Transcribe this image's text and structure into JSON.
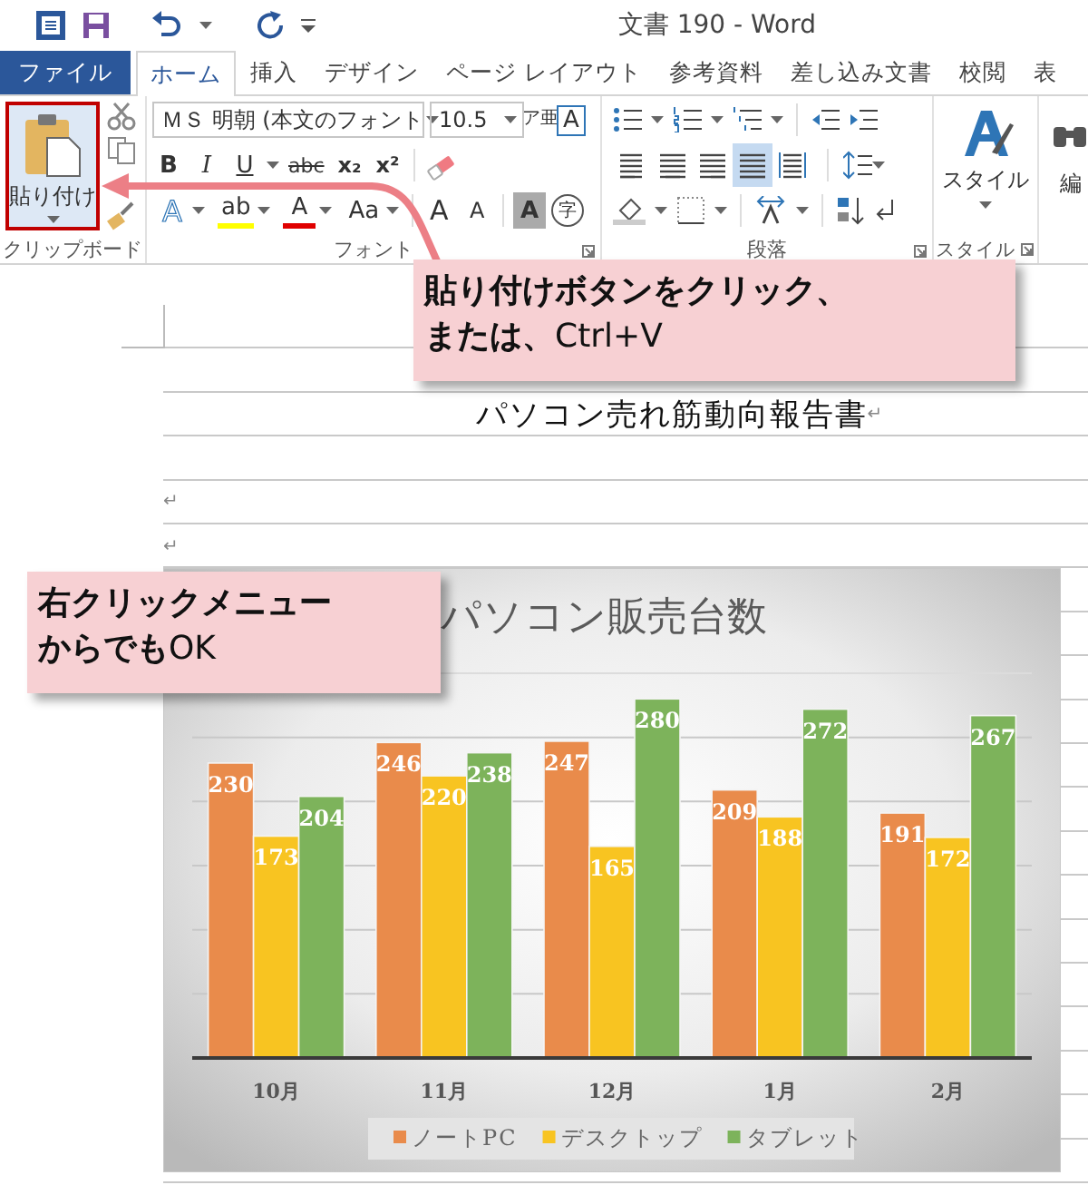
{
  "title_bar": {
    "title": "文書 190 - Word"
  },
  "tabs": [
    {
      "label": "ファイル",
      "kind": "file",
      "selected": false
    },
    {
      "label": "ホーム",
      "kind": "tab",
      "selected": true
    },
    {
      "label": "挿入",
      "kind": "tab",
      "selected": false
    },
    {
      "label": "デザイン",
      "kind": "tab",
      "selected": false
    },
    {
      "label": "ページ レイアウト",
      "kind": "tab",
      "selected": false
    },
    {
      "label": "参考資料",
      "kind": "tab",
      "selected": false
    },
    {
      "label": "差し込み文書",
      "kind": "tab",
      "selected": false
    },
    {
      "label": "校閲",
      "kind": "tab",
      "selected": false
    },
    {
      "label": "表",
      "kind": "tab",
      "selected": false
    }
  ],
  "ribbon": {
    "clipboard": {
      "paste_label": "貼り付け",
      "highlighted": true,
      "group_label": "クリップボード"
    },
    "font": {
      "font_name": "ＭＳ 明朝 (本文のフォント",
      "font_size": "10.5",
      "phonetic_button": "ア亜",
      "border_button": "A",
      "format_buttons": [
        "B",
        "I",
        "U",
        "abc",
        "x₂",
        "x²"
      ],
      "effect_buttons": [
        "A",
        "ab",
        "A",
        "Aa"
      ],
      "size_buttons": [
        "A",
        "A"
      ],
      "shade_buttons": [
        "A",
        "字"
      ],
      "group_label": "フォント"
    },
    "paragraph": {
      "align_buttons": [
        {
          "kind": "left",
          "selected": false
        },
        {
          "kind": "center",
          "selected": false
        },
        {
          "kind": "right",
          "selected": false
        },
        {
          "kind": "justify",
          "selected": true
        },
        {
          "kind": "distribute",
          "selected": false
        }
      ],
      "group_label": "段落"
    },
    "styles": {
      "label": "スタイル",
      "group_label": "スタイル"
    },
    "editing": {
      "label": "編"
    }
  },
  "document": {
    "heading": "パソコン売れ筋動向報告書",
    "heading_mark": "↵",
    "paragraph_marks": [
      "↵",
      "↵"
    ],
    "chart": {
      "chart_data": {
        "type": "bar",
        "title": "パソコン販売台数",
        "categories": [
          "10月",
          "11月",
          "12月",
          "1月",
          "2月"
        ],
        "ylim": [
          0,
          300
        ],
        "data_labels": true,
        "legend": "bottom",
        "series": [
          {
            "name": "ノートPC",
            "color": "#e98b4b",
            "values": [
              230,
              246,
              247,
              209,
              191
            ]
          },
          {
            "name": "デスクトップ",
            "color": "#f8c421",
            "values": [
              173,
              220,
              165,
              188,
              172
            ]
          },
          {
            "name": "タブレット",
            "color": "#7db35b",
            "values": [
              204,
              238,
              280,
              272,
              267
            ]
          }
        ]
      }
    }
  },
  "callouts": [
    {
      "lines": [
        "**貼り付けボタンをクリック、**",
        "**または、**Ctrl+V"
      ]
    },
    {
      "lines": [
        "**右クリックメニュー**",
        "**からでも**OK"
      ]
    }
  ]
}
